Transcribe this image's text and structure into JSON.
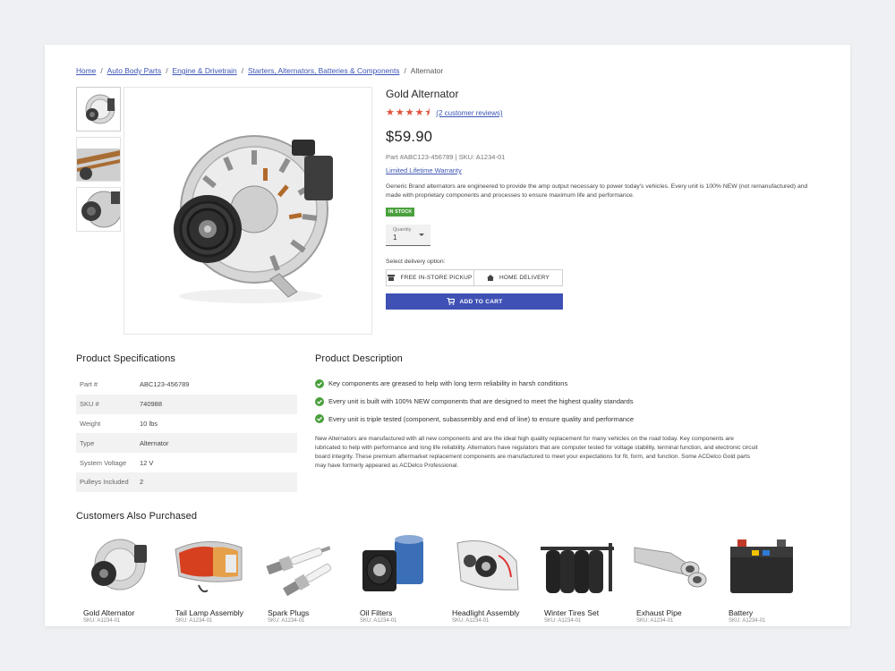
{
  "breadcrumb": {
    "items": [
      "Home",
      "Auto Body Parts",
      "Engine & Drivetrain",
      "Starters, Alternators, Batteries & Components"
    ],
    "current": "Alternator",
    "separator": "/"
  },
  "product": {
    "title": "Gold Alternator",
    "rating": 4.5,
    "rating_stars": "★★★★⯨",
    "reviews_link": "(2 customer reviews)",
    "price": "$59.90",
    "part_info": "Part #ABC123-456789 | SKU: A1234-01",
    "warranty_link": "Limited Lifetime Warranty",
    "blurb": "Generic Brand alternators are engineered to provide the amp output necessary to power today's vehicles. Every unit is 100% NEW (not remanufactured) and made with proprietary components and processes to ensure maximum life and performance.",
    "stock_badge": "IN STOCK",
    "quantity_label": "Quantity",
    "quantity_value": "1",
    "delivery_label": "Select delivery option:",
    "pickup_label": "FREE IN-STORE PICKUP",
    "delivery_label_btn": "HOME DELIVERY",
    "add_to_cart": "ADD TO CART"
  },
  "specs": {
    "title": "Product Specifications",
    "rows": [
      {
        "label": "Part #",
        "value": "ABC123-456789"
      },
      {
        "label": "SKU #",
        "value": "740988"
      },
      {
        "label": "Weight",
        "value": "10 lbs"
      },
      {
        "label": "Type",
        "value": "Alternator"
      },
      {
        "label": "System Voltage",
        "value": "12 V"
      },
      {
        "label": "Pulleys Included",
        "value": "2"
      }
    ]
  },
  "description": {
    "title": "Product Description",
    "bullets": [
      "Key components are greased to help with long term reliability in harsh conditions",
      "Every unit is built with 100% NEW components that are designed to meet the highest quality standards",
      "Every unit is triple tested (component, subassembly and end of line) to ensure quality and performance"
    ],
    "paragraph": "New Alternators are manufactured with all new components and are the ideal high quality replacement for many vehicles on the road today. Key components are lubricated to help with performance and long life reliability. Alternators have regulators that are computer tested for voltage stability, terminal function, and electronic circuit board integrity. These premium aftermarket replacement components are manufactured to meet your expectations for fit, form, and function. Some ACDelco Gold parts may have formerly appeared as ACDelco Professional."
  },
  "also_purchased": {
    "title": "Customers Also Purchased",
    "items": [
      {
        "name": "Gold Alternator",
        "sku": "SKU: A1234-01"
      },
      {
        "name": "Tail Lamp Assembly",
        "sku": "SKU: A1234-01"
      },
      {
        "name": "Spark Plugs",
        "sku": "SKU: A1234-01"
      },
      {
        "name": "Oil Filters",
        "sku": "SKU: A1234-01"
      },
      {
        "name": "Headlight Assembly",
        "sku": "SKU: A1234-01"
      },
      {
        "name": "Winter Tires Set",
        "sku": "SKU: A1234-01"
      },
      {
        "name": "Exhaust Pipe",
        "sku": "SKU: A1234-01"
      },
      {
        "name": "Battery",
        "sku": "SKU: A1234-01"
      }
    ]
  },
  "colors": {
    "link": "#3b54b4",
    "accent_button": "#3f51b5",
    "stars": "#e0523a",
    "in_stock": "#4aa03d",
    "check": "#4aa03d"
  }
}
